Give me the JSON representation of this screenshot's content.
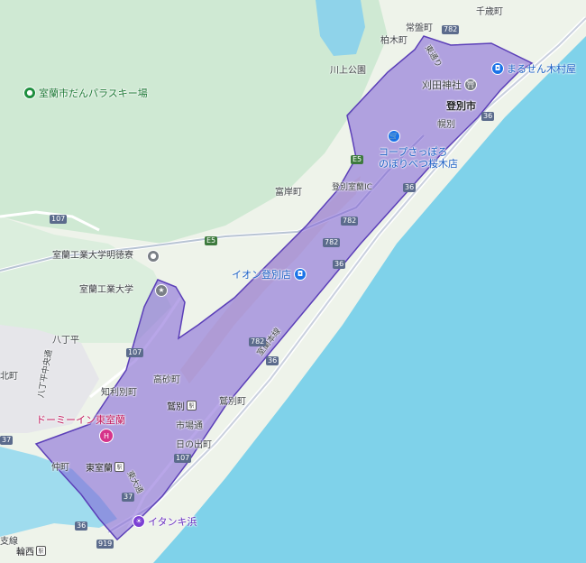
{
  "map": {
    "area_color": "#7e5cd6",
    "sea_color": "#7fd2ea",
    "land_color": "#eaf2e4",
    "forest_color": "#cbe8cf",
    "highlight_area": "登別市・室蘭市東部"
  },
  "places": {
    "senzai": "千歳町",
    "tokiwa": "常盤町",
    "kashiwagi": "柏木町",
    "kawakami_park": "川上公園",
    "noboribetsu_city": "登別市",
    "horobetsu": "幌別",
    "tomikishi": "富岸町",
    "yachidaira": "八丁平",
    "chiribetsu": "知利別町",
    "takasago": "高砂町",
    "washibetsu": "鷲別",
    "washibetsu_cho": "鷲別町",
    "ichiba": "市場通",
    "hinode": "日の出町",
    "higashi_muroran": "東室蘭",
    "naka": "仲町",
    "wanishi": "輪西",
    "hakkou_naka": "八丁平中央通",
    "kita": "北町",
    "muroran_univ": "室蘭工業大学",
    "muroran_dorm": "室蘭工業大学明徳寮",
    "noboribetsu_ic": "登別室蘭IC",
    "shiri": "支線",
    "higashi_dori": "東通り",
    "higashi_odori": "東大通",
    "muroran_line": "室蘭本線"
  },
  "pois": {
    "ski": "室蘭市だんパラスキー場",
    "kanda_shrine": "刈田神社",
    "marusen": "まるせん木村屋",
    "coop": "コープさっぽろ のぼりべつ桜木店",
    "coop_line1": "コープさっぽろ",
    "coop_line2": "のぼりべつ桜木店",
    "aeon": "イオン登別店",
    "dormy": "ドーミーイン東室蘭",
    "itanki": "イタンキ浜"
  },
  "routes": {
    "r782_a": "782",
    "r782_b": "782",
    "r782_c": "782",
    "r782_d": "782",
    "r36_a": "36",
    "r36_b": "36",
    "r36_c": "36",
    "r36_d": "36",
    "r36_e": "36",
    "r107_a": "107",
    "r107_b": "107",
    "r107_c": "107",
    "r37": "37",
    "r919": "919",
    "r7": "37",
    "e5_a": "E5",
    "e5_b": "E5"
  },
  "icons": {
    "park": "park-pin-icon",
    "shopping": "shopping-bag-icon",
    "cart": "shopping-cart-icon",
    "shrine": "shrine-icon",
    "hotel": "hotel-icon",
    "beach": "beach-icon",
    "school": "school-icon",
    "station": "train-station-icon"
  }
}
